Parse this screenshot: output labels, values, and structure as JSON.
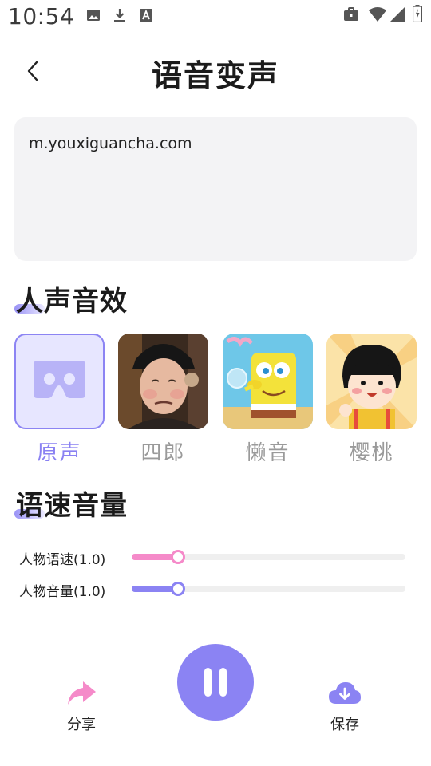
{
  "status_bar": {
    "time": "10:54",
    "icons": [
      "image-icon",
      "download-icon",
      "font-icon",
      "briefcase-icon",
      "wifi-icon",
      "signal-icon",
      "battery-icon"
    ]
  },
  "header": {
    "title": "语音变声",
    "back_icon": "chevron-left-icon"
  },
  "text_input": {
    "value": "m.youxiguancha.com"
  },
  "sections": {
    "effects_title": "人声音效",
    "speed_volume_title": "语速音量"
  },
  "effects": [
    {
      "label": "原声",
      "selected": true,
      "icon": "vr-glasses-icon"
    },
    {
      "label": "四郎",
      "selected": false,
      "icon": "man-portrait-image"
    },
    {
      "label": "懒音",
      "selected": false,
      "icon": "spongebob-image"
    },
    {
      "label": "樱桃",
      "selected": false,
      "icon": "cartoon-girl-image"
    }
  ],
  "sliders": [
    {
      "label": "人物语速(1.0)",
      "value": 1.0,
      "level": 0.17,
      "color": "#f58ac9"
    },
    {
      "label": "人物音量(1.0)",
      "value": 1.0,
      "level": 0.17,
      "color": "#8b83f3"
    }
  ],
  "bottom": {
    "share_label": "分享",
    "save_label": "保存",
    "share_icon": "share-arrow-icon",
    "save_icon": "cloud-download-icon",
    "play_icon": "pause-icon"
  },
  "colors": {
    "accent": "#8b83f3",
    "accent_light": "#e7e6ff",
    "pink": "#f58ac9",
    "card_bg": "#f3f3f5"
  }
}
